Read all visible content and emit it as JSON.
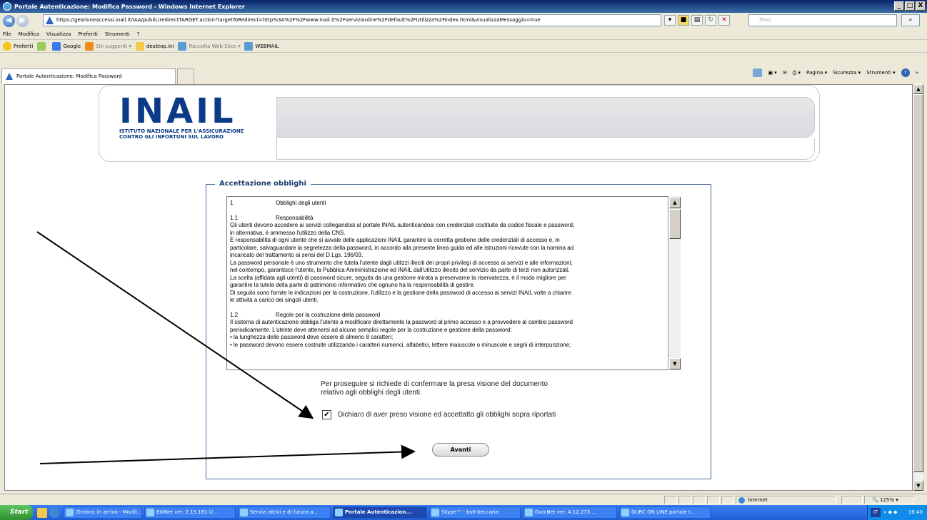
{
  "window": {
    "title": "Portale Autenticazione: Modifica Password - Windows Internet Explorer",
    "btn_min": "_",
    "btn_max": "□",
    "btn_close": "X"
  },
  "address": {
    "url": "https://gestioneaccessi.inail.it/IAA/public/redirectTARGET.action?targetToRedirect=http%3A%2F%2Fwww.inail.it%2Fservizionline%2Fdefault%2FUtilizza%2Findex.html&visualizzaMessaggio=true",
    "search_placeholder": "Trovi"
  },
  "menu": [
    "File",
    "Modifica",
    "Visualizza",
    "Preferiti",
    "Strumenti",
    "?"
  ],
  "favorites": {
    "label": "Preferiti",
    "items": [
      "Google",
      "Siti suggeriti ▾",
      "desktop.ini",
      "Raccolta Web Slice ▾",
      "WEBMAIL"
    ]
  },
  "tab": {
    "label": "Portale Autenticazione: Modifica Password"
  },
  "commands": [
    "Pagina ▾",
    "Sicurezza ▾",
    "Strumenti ▾"
  ],
  "header": {
    "logo": "INAIL",
    "logo_sub_1": "ISTITUTO NAZIONALE PER L'ASSICURAZIONE",
    "logo_sub_2": "CONTRO GLI INFORTUNI SUL LAVORO"
  },
  "form": {
    "legend": "Accettazione obblighi",
    "doc_lines": [
      {
        "num": "1",
        "text": "Obblighi degli utenti"
      },
      {
        "num": "",
        "text": ""
      },
      {
        "num": "1.1",
        "text": "Responsabilità"
      },
      {
        "num": "",
        "text": "Gli utenti devono accedere ai servizi collegandosi al portale INAIL autenticandosi con credenziali costituite da codice fiscale e password;"
      },
      {
        "num": "",
        "text": "in alternativa, è ammesso l'utilizzo della CNS."
      },
      {
        "num": "",
        "text": "È responsabilità di ogni utente che si avvale delle applicazioni INAIL garantire la corretta gestione delle credenziali di accesso e, in"
      },
      {
        "num": "",
        "text": "particolare, salvaguardare la segretezza della password, in accordo alla presente linea guida ed alle istruzioni ricevute con la nomina ad"
      },
      {
        "num": "",
        "text": "incaricato del trattamento ai sensi del D.Lgs. 196/03."
      },
      {
        "num": "",
        "text": "La password personale è uno strumento che tutela l'utente dagli utilizzi illeciti dei propri privilegi di accesso ai servizi e alle informazioni;"
      },
      {
        "num": "",
        "text": "nel contempo, garantisce l'utente, la Pubblica Amministrazione ed INAIL dall'utilizzo illecito del servizio da parte di terzi non autorizzati."
      },
      {
        "num": "",
        "text": "La scelta (affidata agli utenti) di password sicure, seguita da una gestione mirata a preservarne la riservatezza, è il modo migliore per"
      },
      {
        "num": "",
        "text": "garantire la tutela della parte di patrimonio informativo che ognuno ha la responsabilità di gestire."
      },
      {
        "num": "",
        "text": "Di seguito sono fornite le indicazioni per la costruzione, l'utilizzo e la gestione della password di accesso ai servizi INAIL volte a chiarire"
      },
      {
        "num": "",
        "text": "le attività a carico dei singoli utenti."
      },
      {
        "num": "",
        "text": ""
      },
      {
        "num": "1.2",
        "text": "Regole per la costruzione della password"
      },
      {
        "num": "",
        "text": "Il sistema di autenticazione obbliga l'utente a modificare direttamente la password al primo accesso e a provvedere al cambio password"
      },
      {
        "num": "",
        "text": "periodicamente. L'utente deve attenersi ad alcune semplici regole per la costruzione e gestione della password:"
      },
      {
        "num": "",
        "text": "• la lunghezza delle password deve essere di almeno 8 caratteri;"
      },
      {
        "num": "",
        "text": "• le password devono essere costruite utilizzando i caratteri numerici, alfabetici, lettere maiuscole o minuscole e segni di interpunzione;"
      }
    ],
    "confirm_line1": "Per proseguire si richiede di confermare la presa visione del documento",
    "confirm_line2": "relativo agli obblighi degli utenti.",
    "checkbox_checked": true,
    "checkbox_mark": "✔",
    "checkbox_label": "Dichiaro di aver preso visione ed accettatto gli obblighi sopra riportati",
    "submit_label": "Avanti"
  },
  "status": {
    "zone": "Internet",
    "zoom": "125%"
  },
  "taskbar": {
    "start": "Start",
    "tasks": [
      {
        "label": "Zimbra: In arrivo - Mozill...",
        "active": false
      },
      {
        "label": "EdiNet  ver. 2.15.181 U...",
        "active": false
      },
      {
        "label": "Servizi attivi e di futura a...",
        "active": false
      },
      {
        "label": "Portale Autenticazion...",
        "active": true
      },
      {
        "label": "Skype™ - bs0-beccaria",
        "active": false
      },
      {
        "label": "DurcNet  ver. 4.12.273 ...",
        "active": false
      },
      {
        "label": "DURC ON LINE portale I...",
        "active": false
      }
    ],
    "lang": "IT",
    "clock": "16:40"
  }
}
